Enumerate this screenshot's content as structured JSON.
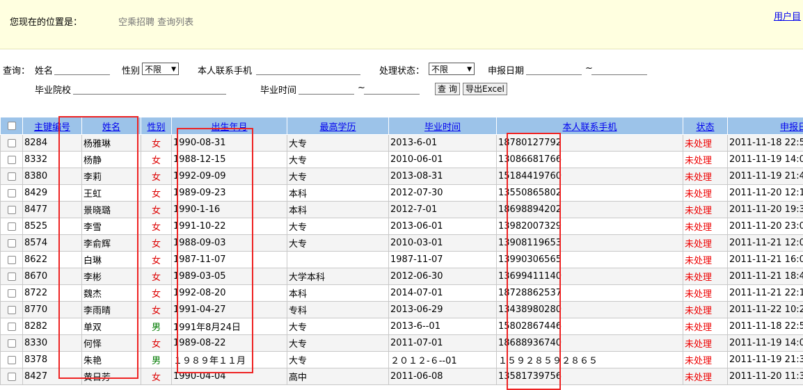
{
  "top": {
    "location_label": "您现在的位置是：",
    "path": "空乘招聘 查询列表",
    "user_link": "用户目"
  },
  "filters": {
    "query_label": "查询：",
    "name_label": "姓名",
    "gender_label": "性别",
    "gender_value": "不限",
    "phone_label": "本人联系手机",
    "status_label": "处理状态：",
    "status_value": "不限",
    "report_date_label": "申报日期",
    "tilde": "~",
    "school_label": "毕业院校",
    "grad_time_label": "毕业时间",
    "search_button": "查 询",
    "export_button": "导出Excel"
  },
  "table": {
    "headers": [
      "主键编号",
      "姓名",
      "性别",
      "出生年月",
      "最高学历",
      "毕业时间",
      "本人联系手机",
      "状态",
      "申报日"
    ],
    "rows": [
      {
        "id": "8284",
        "name": "杨雅琳",
        "sex": "女",
        "birth": "1990-08-31",
        "edu": "大专",
        "grad": "2013-6-01",
        "phone": "18780127792",
        "status": "未处理",
        "date": "2011-11-18 22:5"
      },
      {
        "id": "8332",
        "name": "杨静",
        "sex": "女",
        "birth": "1988-12-15",
        "edu": "大专",
        "grad": "2010-06-01",
        "phone": "13086681766",
        "status": "未处理",
        "date": "2011-11-19 14:0"
      },
      {
        "id": "8380",
        "name": "李莉",
        "sex": "女",
        "birth": "1992-09-09",
        "edu": "大专",
        "grad": "2013-08-31",
        "phone": "15184419760",
        "status": "未处理",
        "date": "2011-11-19 21:4"
      },
      {
        "id": "8429",
        "name": "王虹",
        "sex": "女",
        "birth": "1989-09-23",
        "edu": "本科",
        "grad": "2012-07-30",
        "phone": "13550865802",
        "status": "未处理",
        "date": "2011-11-20 12:1"
      },
      {
        "id": "8477",
        "name": "景晓璐",
        "sex": "女",
        "birth": "1990-1-16",
        "edu": "本科",
        "grad": "2012-7-01",
        "phone": "18698894202",
        "status": "未处理",
        "date": "2011-11-20 19:3"
      },
      {
        "id": "8525",
        "name": "李雪",
        "sex": "女",
        "birth": "1991-10-22",
        "edu": "大专",
        "grad": "2013-06-01",
        "phone": "13982007329",
        "status": "未处理",
        "date": "2011-11-20 23:0"
      },
      {
        "id": "8574",
        "name": "李俞辉",
        "sex": "女",
        "birth": "1988-09-03",
        "edu": "大专",
        "grad": "2010-03-01",
        "phone": "13908119653",
        "status": "未处理",
        "date": "2011-11-21 12:0"
      },
      {
        "id": "8622",
        "name": "白琳",
        "sex": "女",
        "birth": "1987-11-07",
        "edu": "",
        "grad": "1987-11-07",
        "phone": "13990306565",
        "status": "未处理",
        "date": "2011-11-21 16:0"
      },
      {
        "id": "8670",
        "name": "李彬",
        "sex": "女",
        "birth": "1989-03-05",
        "edu": "大学本科",
        "grad": "2012-06-30",
        "phone": "13699411140",
        "status": "未处理",
        "date": "2011-11-21 18:4"
      },
      {
        "id": "8722",
        "name": "魏杰",
        "sex": "女",
        "birth": "1992-08-20",
        "edu": "本科",
        "grad": "2014-07-01",
        "phone": "18728862537",
        "status": "未处理",
        "date": "2011-11-21 22:1"
      },
      {
        "id": "8770",
        "name": "李雨晴",
        "sex": "女",
        "birth": "1991-04-27",
        "edu": "专科",
        "grad": "2013-06-29",
        "phone": "13438980280",
        "status": "未处理",
        "date": "2011-11-22 10:2"
      },
      {
        "id": "8282",
        "name": "单双",
        "sex": "男",
        "birth": "1991年8月24日",
        "edu": "大专",
        "grad": "2013-6--01",
        "phone": "15802867446",
        "status": "未处理",
        "date": "2011-11-18 22:5"
      },
      {
        "id": "8330",
        "name": "何怿",
        "sex": "女",
        "birth": "1989-08-22",
        "edu": "大专",
        "grad": "2011-07-01",
        "phone": "18688936740",
        "status": "未处理",
        "date": "2011-11-19 14:0"
      },
      {
        "id": "8378",
        "name": "朱艳",
        "sex": "男",
        "birth": "１９８９年１１月",
        "edu": "大专",
        "grad": "２０１２-６--01",
        "phone": "１５９２８５９２８６５",
        "status": "未处理",
        "date": "2011-11-19 21:3"
      },
      {
        "id": "8427",
        "name": "黄日芳",
        "sex": "女",
        "birth": "1990-04-04",
        "edu": "高中",
        "grad": "2011-06-08",
        "phone": "13581739756",
        "status": "未处理",
        "date": "2011-11-20 11:3"
      }
    ]
  }
}
